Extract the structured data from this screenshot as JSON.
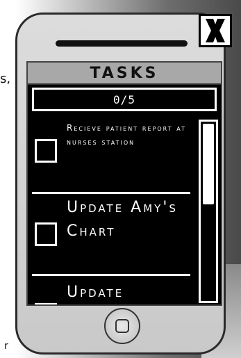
{
  "background": {
    "partial_text_left": "s,",
    "partial_text_bottom": "r"
  },
  "close_button": {
    "label": "X"
  },
  "panel": {
    "title": "TASKS",
    "progress": "0/5"
  },
  "tasks": [
    {
      "label": "Recieve patient report at nurses station",
      "checked": false
    },
    {
      "label": "Update Amy's Chart",
      "checked": false
    },
    {
      "label": "Update",
      "checked": false
    }
  ],
  "scroll": {
    "position_fraction": 0.0
  }
}
